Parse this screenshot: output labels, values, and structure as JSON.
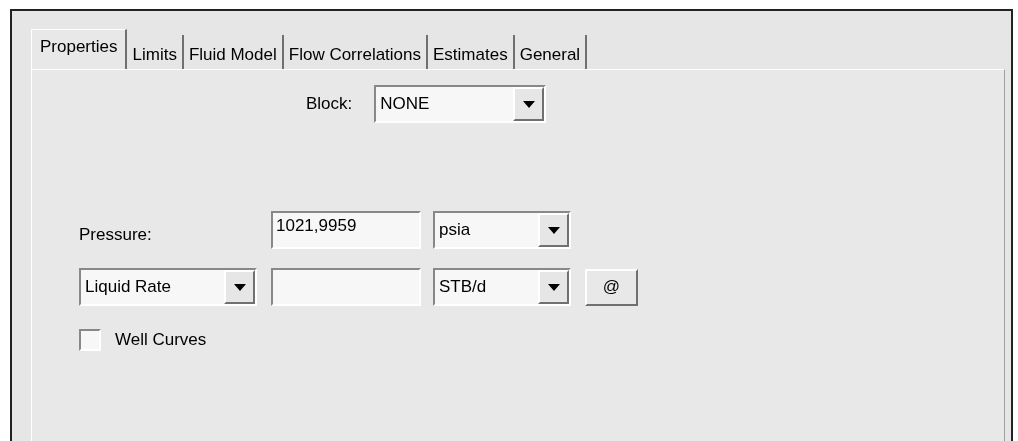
{
  "tabs": [
    {
      "label": "Properties",
      "selected": true
    },
    {
      "label": "Limits",
      "selected": false
    },
    {
      "label": "Fluid Model",
      "selected": false
    },
    {
      "label": "Flow Correlations",
      "selected": false
    },
    {
      "label": "Estimates",
      "selected": false
    },
    {
      "label": "General",
      "selected": false
    }
  ],
  "block": {
    "label": "Block:",
    "value": "NONE"
  },
  "pressure": {
    "label": "Pressure:",
    "value": "1021,9959",
    "unit": "psia"
  },
  "rate": {
    "type": "Liquid Rate",
    "unit": "STB/d",
    "button": "@"
  },
  "well_curves": {
    "label": "Well Curves",
    "checked": false
  }
}
